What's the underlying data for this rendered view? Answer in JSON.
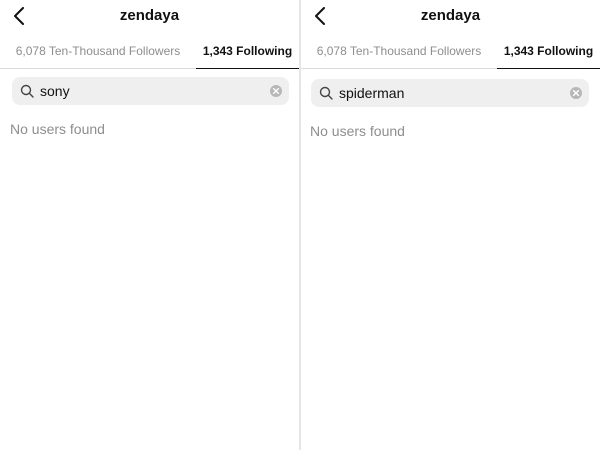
{
  "left": {
    "title": "zendaya",
    "tabs": {
      "followers": "6,078 Ten-Thousand Followers",
      "following": "1,343 Following"
    },
    "search": {
      "value": "sony"
    },
    "empty_message": "No users found"
  },
  "right": {
    "title": "zendaya",
    "tabs": {
      "followers": "6,078 Ten-Thousand Followers",
      "following": "1,343 Following"
    },
    "search": {
      "value": "spiderman"
    },
    "empty_message": "No users found"
  },
  "icons": {
    "back": "chevron-left-icon",
    "search": "search-icon",
    "clear": "clear-icon"
  },
  "colors": {
    "text_primary": "#111111",
    "text_secondary": "#8e8e8e",
    "search_bg": "#efefef"
  }
}
